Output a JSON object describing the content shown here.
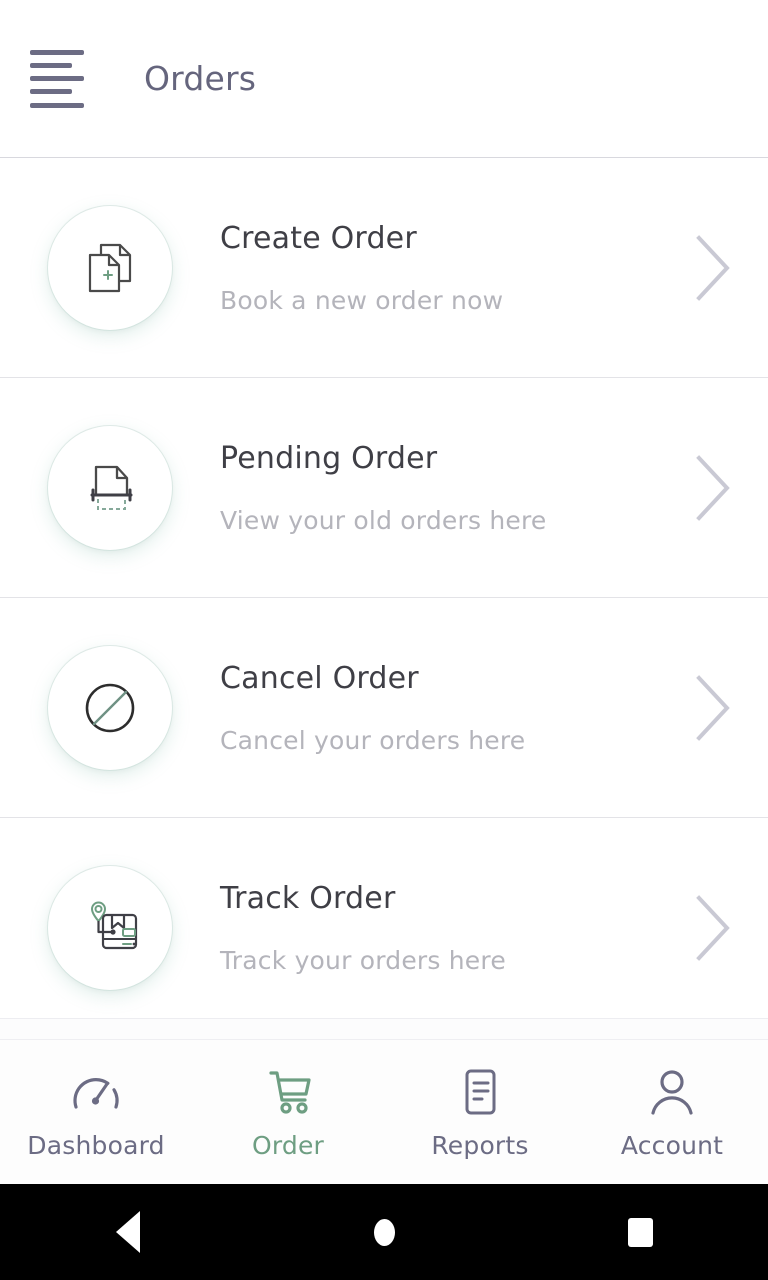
{
  "appbar": {
    "menu_icon": "hamburger-menu-icon",
    "title": "Orders"
  },
  "colors": {
    "accent_green": "#6e9e82",
    "title_text": "#3f3f46",
    "subtitle_text": "#b4b4bb",
    "nav_text": "#6c6c84",
    "divider": "#e3e3e7",
    "background": "#ffffff"
  },
  "list": {
    "rows": [
      {
        "title": "Create Order",
        "subtitle": "Book a new order now",
        "icon": "documents-plus-icon",
        "chevron": "chevron-right-icon"
      },
      {
        "title": "Pending Order",
        "subtitle": "View your old orders here",
        "icon": "document-pending-icon",
        "chevron": "chevron-right-icon"
      },
      {
        "title": "Cancel Order",
        "subtitle": "Cancel your orders here",
        "icon": "circle-slash-icon",
        "chevron": "chevron-right-icon"
      },
      {
        "title": "Track Order",
        "subtitle": "Track your orders here",
        "icon": "package-location-icon",
        "chevron": "chevron-right-icon"
      }
    ]
  },
  "bottom_nav": {
    "items": [
      {
        "label": "Dashboard",
        "icon": "speedometer-icon",
        "active": false
      },
      {
        "label": "Order",
        "icon": "shopping-cart-icon",
        "active": true
      },
      {
        "label": "Reports",
        "icon": "document-lines-icon",
        "active": false
      },
      {
        "label": "Account",
        "icon": "user-person-icon",
        "active": false
      }
    ]
  },
  "system_bar": {
    "back": "back-triangle-icon",
    "home": "home-circle-icon",
    "recent": "recent-apps-square-icon"
  }
}
